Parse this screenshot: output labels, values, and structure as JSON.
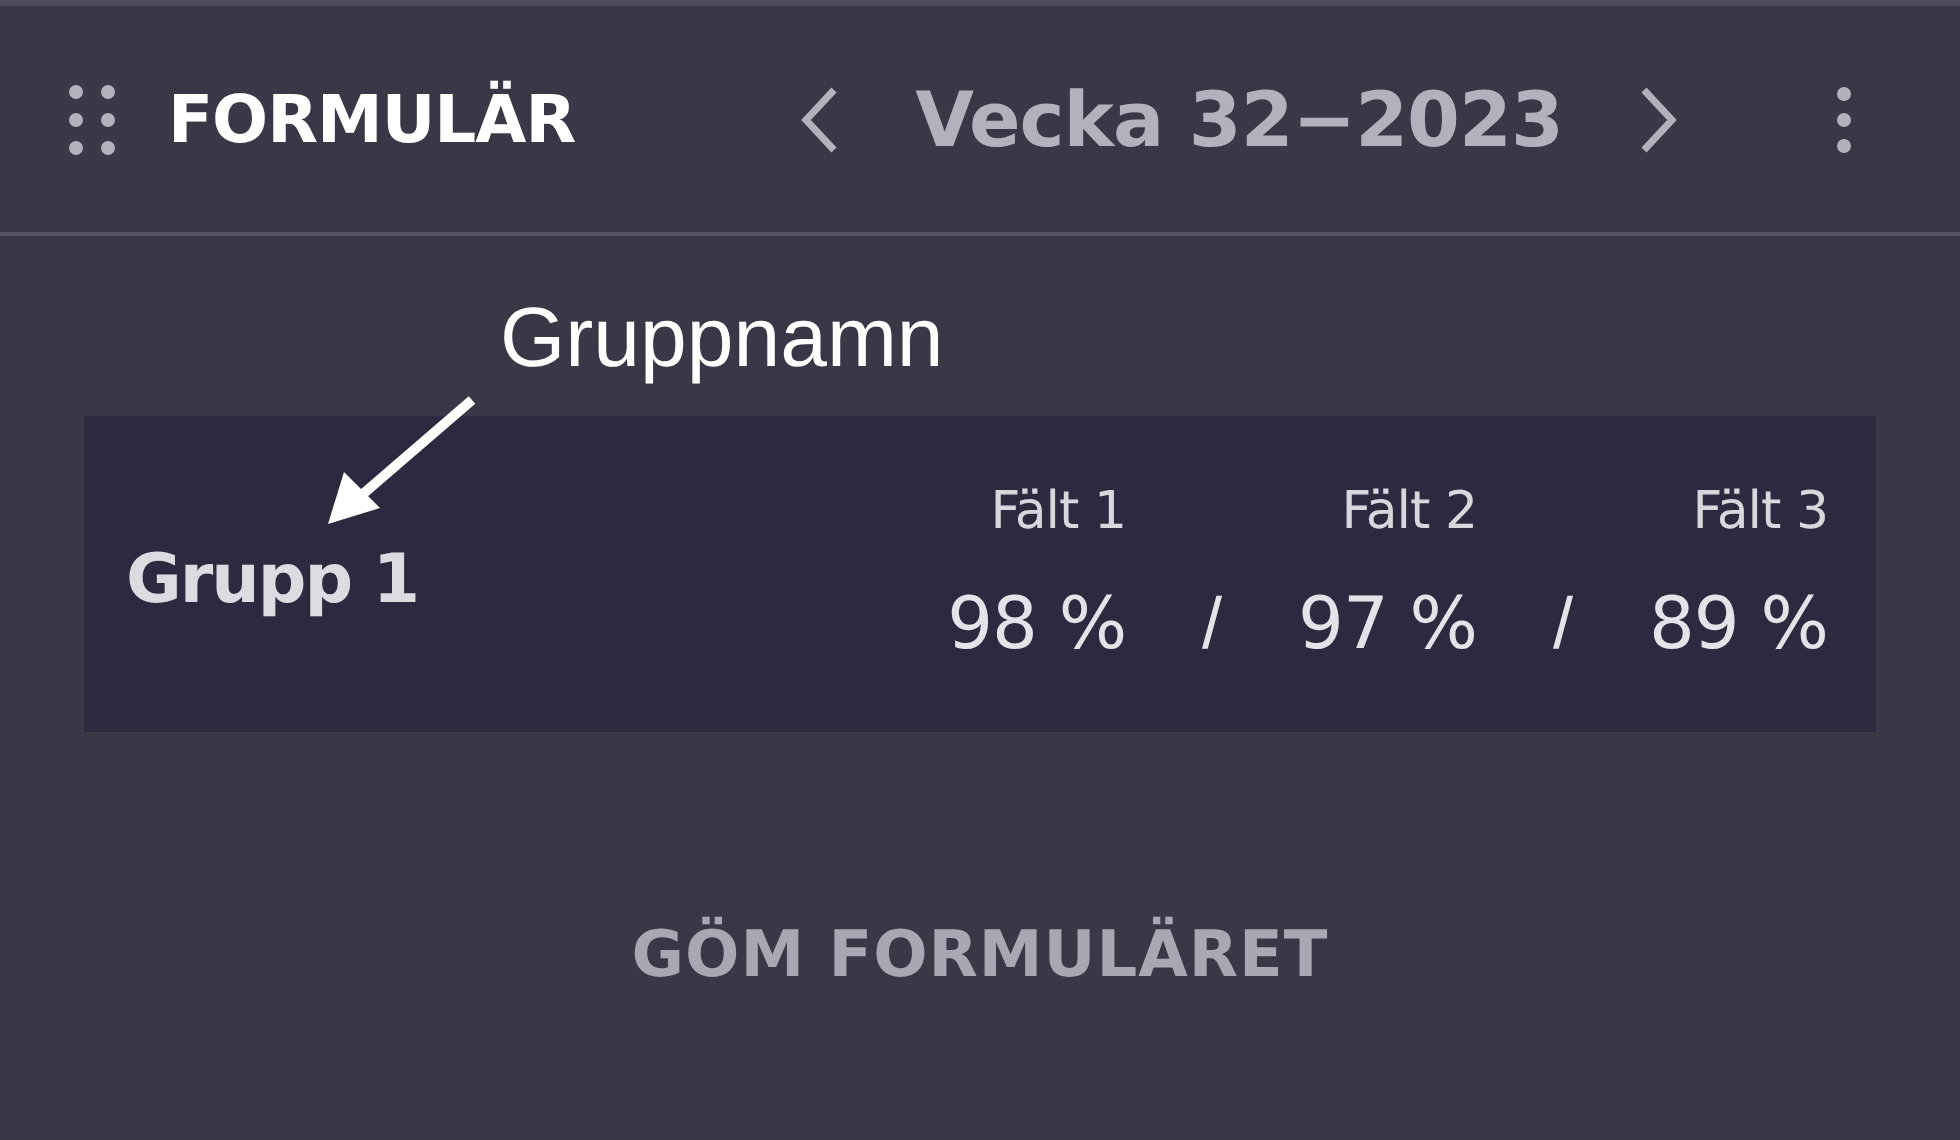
{
  "header": {
    "title": "FORMULÄR",
    "week": "Vecka 32−2023"
  },
  "annotation": {
    "text": "Gruppnamn"
  },
  "group": {
    "name": "Grupp 1",
    "fields": [
      {
        "label": "Fält 1",
        "value": "98 %"
      },
      {
        "label": "Fält 2",
        "value": "97 %"
      },
      {
        "label": "Fält 3",
        "value": "89 %"
      }
    ],
    "separators": [
      "/",
      "/"
    ]
  },
  "hide_button": {
    "label": "GÖM FORMULÄRET"
  }
}
